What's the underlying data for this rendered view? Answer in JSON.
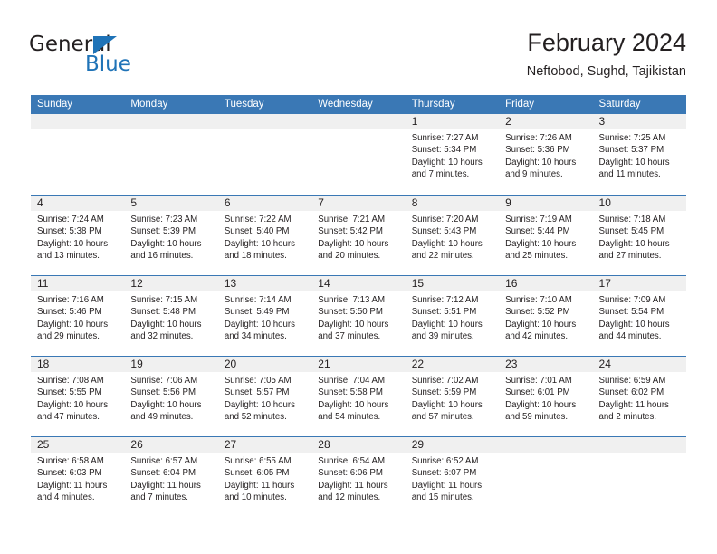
{
  "brand": {
    "name_top": "General",
    "name_bottom": "Blue",
    "accent_color": "#1f73b7"
  },
  "header": {
    "title": "February 2024",
    "subtitle": "Neftobod, Sughd, Tajikistan"
  },
  "calendar": {
    "header_bg": "#3a78b5",
    "header_text_color": "#ffffff",
    "daynum_band_bg": "#f0f0f0",
    "weekdays": [
      "Sunday",
      "Monday",
      "Tuesday",
      "Wednesday",
      "Thursday",
      "Friday",
      "Saturday"
    ],
    "weeks": [
      [
        {
          "day": ""
        },
        {
          "day": ""
        },
        {
          "day": ""
        },
        {
          "day": ""
        },
        {
          "day": "1",
          "sunrise": "Sunrise: 7:27 AM",
          "sunset": "Sunset: 5:34 PM",
          "daylight_line1": "Daylight: 10 hours",
          "daylight_line2": "and 7 minutes."
        },
        {
          "day": "2",
          "sunrise": "Sunrise: 7:26 AM",
          "sunset": "Sunset: 5:36 PM",
          "daylight_line1": "Daylight: 10 hours",
          "daylight_line2": "and 9 minutes."
        },
        {
          "day": "3",
          "sunrise": "Sunrise: 7:25 AM",
          "sunset": "Sunset: 5:37 PM",
          "daylight_line1": "Daylight: 10 hours",
          "daylight_line2": "and 11 minutes."
        }
      ],
      [
        {
          "day": "4",
          "sunrise": "Sunrise: 7:24 AM",
          "sunset": "Sunset: 5:38 PM",
          "daylight_line1": "Daylight: 10 hours",
          "daylight_line2": "and 13 minutes."
        },
        {
          "day": "5",
          "sunrise": "Sunrise: 7:23 AM",
          "sunset": "Sunset: 5:39 PM",
          "daylight_line1": "Daylight: 10 hours",
          "daylight_line2": "and 16 minutes."
        },
        {
          "day": "6",
          "sunrise": "Sunrise: 7:22 AM",
          "sunset": "Sunset: 5:40 PM",
          "daylight_line1": "Daylight: 10 hours",
          "daylight_line2": "and 18 minutes."
        },
        {
          "day": "7",
          "sunrise": "Sunrise: 7:21 AM",
          "sunset": "Sunset: 5:42 PM",
          "daylight_line1": "Daylight: 10 hours",
          "daylight_line2": "and 20 minutes."
        },
        {
          "day": "8",
          "sunrise": "Sunrise: 7:20 AM",
          "sunset": "Sunset: 5:43 PM",
          "daylight_line1": "Daylight: 10 hours",
          "daylight_line2": "and 22 minutes."
        },
        {
          "day": "9",
          "sunrise": "Sunrise: 7:19 AM",
          "sunset": "Sunset: 5:44 PM",
          "daylight_line1": "Daylight: 10 hours",
          "daylight_line2": "and 25 minutes."
        },
        {
          "day": "10",
          "sunrise": "Sunrise: 7:18 AM",
          "sunset": "Sunset: 5:45 PM",
          "daylight_line1": "Daylight: 10 hours",
          "daylight_line2": "and 27 minutes."
        }
      ],
      [
        {
          "day": "11",
          "sunrise": "Sunrise: 7:16 AM",
          "sunset": "Sunset: 5:46 PM",
          "daylight_line1": "Daylight: 10 hours",
          "daylight_line2": "and 29 minutes."
        },
        {
          "day": "12",
          "sunrise": "Sunrise: 7:15 AM",
          "sunset": "Sunset: 5:48 PM",
          "daylight_line1": "Daylight: 10 hours",
          "daylight_line2": "and 32 minutes."
        },
        {
          "day": "13",
          "sunrise": "Sunrise: 7:14 AM",
          "sunset": "Sunset: 5:49 PM",
          "daylight_line1": "Daylight: 10 hours",
          "daylight_line2": "and 34 minutes."
        },
        {
          "day": "14",
          "sunrise": "Sunrise: 7:13 AM",
          "sunset": "Sunset: 5:50 PM",
          "daylight_line1": "Daylight: 10 hours",
          "daylight_line2": "and 37 minutes."
        },
        {
          "day": "15",
          "sunrise": "Sunrise: 7:12 AM",
          "sunset": "Sunset: 5:51 PM",
          "daylight_line1": "Daylight: 10 hours",
          "daylight_line2": "and 39 minutes."
        },
        {
          "day": "16",
          "sunrise": "Sunrise: 7:10 AM",
          "sunset": "Sunset: 5:52 PM",
          "daylight_line1": "Daylight: 10 hours",
          "daylight_line2": "and 42 minutes."
        },
        {
          "day": "17",
          "sunrise": "Sunrise: 7:09 AM",
          "sunset": "Sunset: 5:54 PM",
          "daylight_line1": "Daylight: 10 hours",
          "daylight_line2": "and 44 minutes."
        }
      ],
      [
        {
          "day": "18",
          "sunrise": "Sunrise: 7:08 AM",
          "sunset": "Sunset: 5:55 PM",
          "daylight_line1": "Daylight: 10 hours",
          "daylight_line2": "and 47 minutes."
        },
        {
          "day": "19",
          "sunrise": "Sunrise: 7:06 AM",
          "sunset": "Sunset: 5:56 PM",
          "daylight_line1": "Daylight: 10 hours",
          "daylight_line2": "and 49 minutes."
        },
        {
          "day": "20",
          "sunrise": "Sunrise: 7:05 AM",
          "sunset": "Sunset: 5:57 PM",
          "daylight_line1": "Daylight: 10 hours",
          "daylight_line2": "and 52 minutes."
        },
        {
          "day": "21",
          "sunrise": "Sunrise: 7:04 AM",
          "sunset": "Sunset: 5:58 PM",
          "daylight_line1": "Daylight: 10 hours",
          "daylight_line2": "and 54 minutes."
        },
        {
          "day": "22",
          "sunrise": "Sunrise: 7:02 AM",
          "sunset": "Sunset: 5:59 PM",
          "daylight_line1": "Daylight: 10 hours",
          "daylight_line2": "and 57 minutes."
        },
        {
          "day": "23",
          "sunrise": "Sunrise: 7:01 AM",
          "sunset": "Sunset: 6:01 PM",
          "daylight_line1": "Daylight: 10 hours",
          "daylight_line2": "and 59 minutes."
        },
        {
          "day": "24",
          "sunrise": "Sunrise: 6:59 AM",
          "sunset": "Sunset: 6:02 PM",
          "daylight_line1": "Daylight: 11 hours",
          "daylight_line2": "and 2 minutes."
        }
      ],
      [
        {
          "day": "25",
          "sunrise": "Sunrise: 6:58 AM",
          "sunset": "Sunset: 6:03 PM",
          "daylight_line1": "Daylight: 11 hours",
          "daylight_line2": "and 4 minutes."
        },
        {
          "day": "26",
          "sunrise": "Sunrise: 6:57 AM",
          "sunset": "Sunset: 6:04 PM",
          "daylight_line1": "Daylight: 11 hours",
          "daylight_line2": "and 7 minutes."
        },
        {
          "day": "27",
          "sunrise": "Sunrise: 6:55 AM",
          "sunset": "Sunset: 6:05 PM",
          "daylight_line1": "Daylight: 11 hours",
          "daylight_line2": "and 10 minutes."
        },
        {
          "day": "28",
          "sunrise": "Sunrise: 6:54 AM",
          "sunset": "Sunset: 6:06 PM",
          "daylight_line1": "Daylight: 11 hours",
          "daylight_line2": "and 12 minutes."
        },
        {
          "day": "29",
          "sunrise": "Sunrise: 6:52 AM",
          "sunset": "Sunset: 6:07 PM",
          "daylight_line1": "Daylight: 11 hours",
          "daylight_line2": "and 15 minutes."
        },
        {
          "day": ""
        },
        {
          "day": ""
        }
      ]
    ]
  }
}
